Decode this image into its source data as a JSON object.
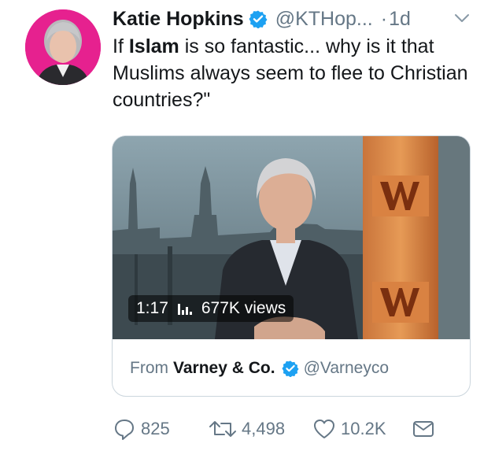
{
  "tweet": {
    "author_name": "Katie Hopkins",
    "handle": "@KTHop...",
    "separator": "·",
    "time": "1d",
    "text_before": "If ",
    "text_bold": "Islam",
    "text_after": " is so fantastic... why is it that Muslims always seem to flee to Christian countries?\""
  },
  "media": {
    "duration": "1:17",
    "views": "677K views",
    "from_label": "From",
    "from_name": "Varney & Co.",
    "from_handle": "@Varneyco"
  },
  "actions": {
    "replies": "825",
    "retweets": "4,498",
    "likes": "10.2K"
  },
  "colors": {
    "verified": "#1da1f2",
    "secondary_text": "#657786",
    "avatar_bg": "#e6218f"
  },
  "icons": [
    "verified-badge-icon",
    "chevron-down-icon",
    "reply-icon",
    "retweet-icon",
    "like-icon",
    "direct-message-icon",
    "view-count-bars-icon"
  ]
}
